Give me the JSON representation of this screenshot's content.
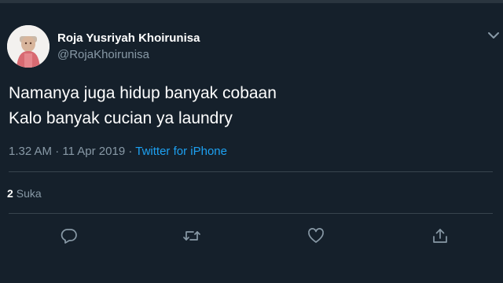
{
  "user": {
    "display_name": "Roja Yusriyah Khoirunisa",
    "handle": "@RojaKhoirunisa"
  },
  "tweet": {
    "lines": [
      "Namanya juga hidup banyak cobaan",
      "Kalo banyak cucian ya laundry"
    ]
  },
  "meta": {
    "time": "1.32 AM",
    "separator": " · ",
    "date": "11 Apr 2019",
    "source": "Twitter for iPhone"
  },
  "stats": {
    "likes_count": "2",
    "likes_label": "Suka"
  },
  "actions": {
    "reply_icon": "reply-icon",
    "retweet_icon": "retweet-icon",
    "like_icon": "heart-icon",
    "share_icon": "share-icon"
  },
  "colors": {
    "background": "#15202b",
    "text_primary": "#ffffff",
    "text_secondary": "#8899a6",
    "accent": "#1da1f2",
    "divider": "#38444d"
  }
}
